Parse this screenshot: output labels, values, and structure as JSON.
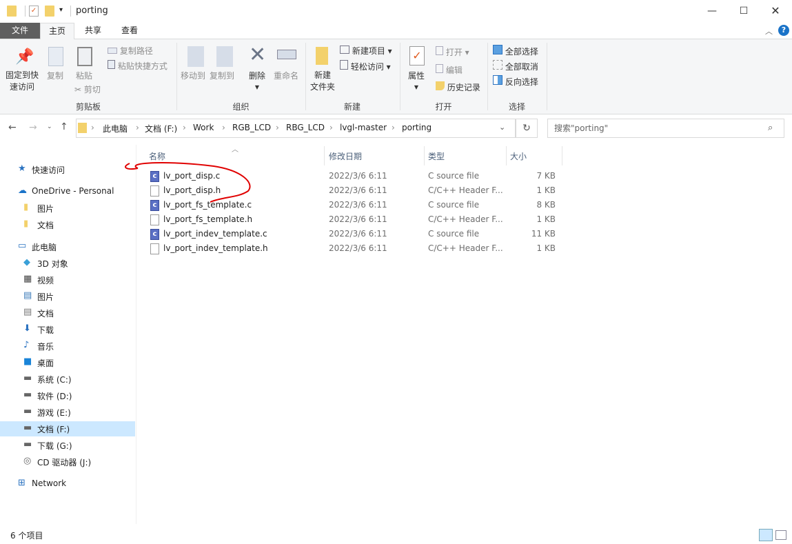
{
  "window": {
    "title": "porting"
  },
  "tabs": {
    "file": "文件",
    "home": "主页",
    "share": "共享",
    "view": "查看"
  },
  "ribbon": {
    "clipboard": {
      "label": "剪贴板",
      "pin": "固定到快",
      "pin2": "速访问",
      "copy": "复制",
      "paste": "粘贴",
      "copy_path": "复制路径",
      "paste_shortcut": "粘贴快捷方式",
      "cut": "剪切"
    },
    "organize": {
      "label": "组织",
      "move_to": "移动到",
      "copy_to": "复制到",
      "delete": "删除",
      "rename": "重命名"
    },
    "new": {
      "label": "新建",
      "new_folder": "新建",
      "new_folder2": "文件夹",
      "new_item": "新建项目",
      "easy_access": "轻松访问"
    },
    "open": {
      "label": "打开",
      "properties": "属性",
      "open": "打开",
      "edit": "编辑",
      "history": "历史记录"
    },
    "select": {
      "label": "选择",
      "select_all": "全部选择",
      "select_none": "全部取消",
      "invert": "反向选择"
    }
  },
  "address": {
    "crumbs": [
      "此电脑",
      "文档 (F:)",
      "Work",
      "RGB_LCD",
      "RBG_LCD",
      "lvgl-master",
      "porting"
    ]
  },
  "search": {
    "placeholder": "搜索\"porting\""
  },
  "sidebar": {
    "items": [
      {
        "label": "快速访问"
      },
      {
        "label": "OneDrive - Personal"
      },
      {
        "label": "图片"
      },
      {
        "label": "文档"
      },
      {
        "label": "此电脑"
      },
      {
        "label": "3D 对象"
      },
      {
        "label": "视频"
      },
      {
        "label": "图片"
      },
      {
        "label": "文档"
      },
      {
        "label": "下载"
      },
      {
        "label": "音乐"
      },
      {
        "label": "桌面"
      },
      {
        "label": "系统 (C:)"
      },
      {
        "label": "软件 (D:)"
      },
      {
        "label": "游戏 (E:)"
      },
      {
        "label": "文档 (F:)"
      },
      {
        "label": "下载 (G:)"
      },
      {
        "label": "CD 驱动器 (J:)"
      },
      {
        "label": "Network"
      }
    ]
  },
  "columns": {
    "name": "名称",
    "date": "修改日期",
    "type": "类型",
    "size": "大小"
  },
  "files": [
    {
      "name": "lv_port_disp.c",
      "date": "2022/3/6 6:11",
      "type": "C source file",
      "size": "7 KB",
      "icon": "c"
    },
    {
      "name": "lv_port_disp.h",
      "date": "2022/3/6 6:11",
      "type": "C/C++ Header F...",
      "size": "1 KB",
      "icon": "h"
    },
    {
      "name": "lv_port_fs_template.c",
      "date": "2022/3/6 6:11",
      "type": "C source file",
      "size": "8 KB",
      "icon": "c"
    },
    {
      "name": "lv_port_fs_template.h",
      "date": "2022/3/6 6:11",
      "type": "C/C++ Header F...",
      "size": "1 KB",
      "icon": "h"
    },
    {
      "name": "lv_port_indev_template.c",
      "date": "2022/3/6 6:11",
      "type": "C source file",
      "size": "11 KB",
      "icon": "c"
    },
    {
      "name": "lv_port_indev_template.h",
      "date": "2022/3/6 6:11",
      "type": "C/C++ Header F...",
      "size": "1 KB",
      "icon": "h"
    }
  ],
  "status": {
    "count": "6 个项目"
  },
  "colors": {
    "file_tab": "#5f5f5f",
    "selected": "#cce8ff",
    "annotation": "#e00000"
  }
}
